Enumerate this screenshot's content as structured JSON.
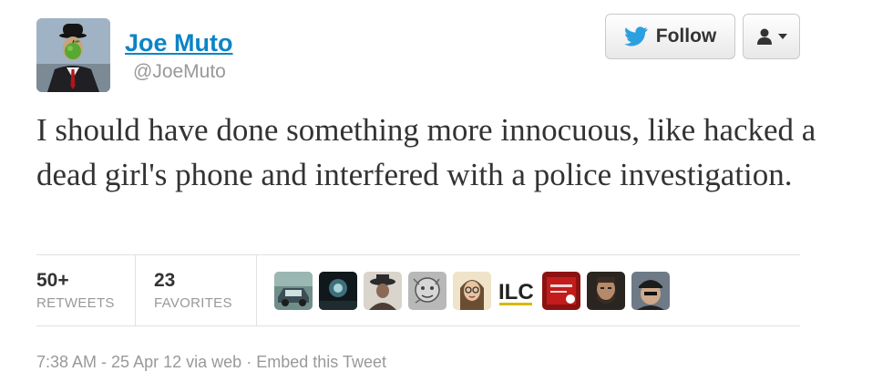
{
  "user": {
    "name": "Joe Muto",
    "handle": "@JoeMuto"
  },
  "actions": {
    "follow_label": "Follow"
  },
  "tweet": {
    "text": "I should have done something more innocuous, like hacked a dead girl's phone and interfered with a police investigation."
  },
  "stats": {
    "retweets_count": "50+",
    "retweets_label": "RETWEETS",
    "favorites_count": "23",
    "favorites_label": "FAVORITES"
  },
  "favoriter_avatars": [
    {
      "name": "avatar-car"
    },
    {
      "name": "avatar-dark-scene"
    },
    {
      "name": "avatar-person-hat"
    },
    {
      "name": "avatar-sketch"
    },
    {
      "name": "avatar-portrait-glasses"
    },
    {
      "name": "avatar-ilc-logo",
      "text": "ILC"
    },
    {
      "name": "avatar-red-book"
    },
    {
      "name": "avatar-bearded-man"
    },
    {
      "name": "avatar-man-cap"
    }
  ],
  "meta": {
    "time": "7:38 AM - 25 Apr 12",
    "via_prefix": "via",
    "via": "web",
    "sep": "·",
    "embed": "Embed this Tweet"
  },
  "colors": {
    "link": "#0b84c6",
    "twitter_bird": "#2ba0e0",
    "muted": "#999999"
  }
}
